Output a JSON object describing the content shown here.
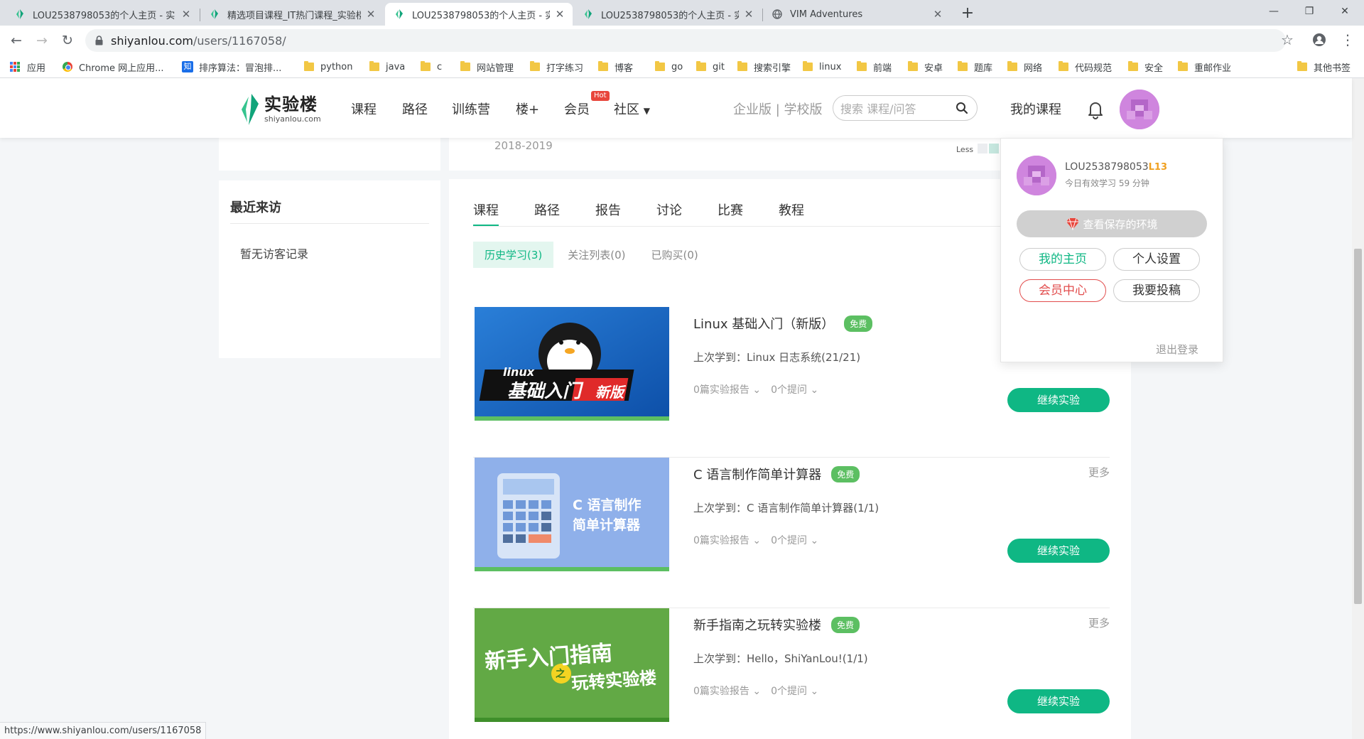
{
  "browser": {
    "tabs": [
      {
        "title": "LOU2538798053的个人主页 - 实",
        "active": false
      },
      {
        "title": "精选项目课程_IT热门课程_实验楼",
        "active": false
      },
      {
        "title": "LOU2538798053的个人主页 - 实",
        "active": true
      },
      {
        "title": "LOU2538798053的个人主页 - 实",
        "active": false
      },
      {
        "title": "VIM Adventures",
        "active": false
      }
    ],
    "url_host": "shiyanlou.com",
    "url_path": "/users/1167058/",
    "bookmarks": [
      {
        "label": "应用",
        "icon": "apps-grid-icon"
      },
      {
        "label": "Chrome 网上应用...",
        "icon": "chrome-icon"
      },
      {
        "label": "排序算法：冒泡排...",
        "icon": "zhihu-icon"
      },
      {
        "label": "python",
        "icon": "folder-icon"
      },
      {
        "label": "java",
        "icon": "folder-icon"
      },
      {
        "label": "c",
        "icon": "folder-icon"
      },
      {
        "label": "网站管理",
        "icon": "folder-icon"
      },
      {
        "label": "打字练习",
        "icon": "folder-icon"
      },
      {
        "label": "博客",
        "icon": "folder-icon"
      },
      {
        "label": "go",
        "icon": "folder-icon"
      },
      {
        "label": "git",
        "icon": "folder-icon"
      },
      {
        "label": "搜索引擎",
        "icon": "folder-icon"
      },
      {
        "label": "linux",
        "icon": "folder-icon"
      },
      {
        "label": "前端",
        "icon": "folder-icon"
      },
      {
        "label": "安卓",
        "icon": "folder-icon"
      },
      {
        "label": "题库",
        "icon": "folder-icon"
      },
      {
        "label": "网络",
        "icon": "folder-icon"
      },
      {
        "label": "代码规范",
        "icon": "folder-icon"
      },
      {
        "label": "安全",
        "icon": "folder-icon"
      },
      {
        "label": "重邮作业",
        "icon": "folder-icon"
      },
      {
        "label": "其他书签",
        "icon": "folder-icon"
      }
    ],
    "status_url": "https://www.shiyanlou.com/users/1167058"
  },
  "site": {
    "logo_cn": "实验楼",
    "logo_en": "shiyanlou.com",
    "nav": [
      "课程",
      "路径",
      "训练营",
      "楼+",
      "会员",
      "社区"
    ],
    "hot_badge": "Hot",
    "enterprise": "企业版 | 学校版",
    "search_placeholder": "搜索 课程/问答",
    "my_courses": "我的课程",
    "accent": "#0fb784"
  },
  "sidebar": {
    "recent_title": "最近来访",
    "recent_empty": "暂无访客记录"
  },
  "calendar": {
    "year_label": "2018-2019",
    "less_label": "Less"
  },
  "main": {
    "tabs": [
      "课程",
      "路径",
      "报告",
      "讨论",
      "比赛",
      "教程"
    ],
    "subtabs": [
      "历史学习(3)",
      "关注列表(0)",
      "已购买(0)"
    ],
    "courses": [
      {
        "title": "Linux 基础入门（新版）",
        "badge": "免费",
        "last": "上次学到：Linux 日志系统(21/21)",
        "reports": "0篇实验报告",
        "questions": "0个提问",
        "more": "",
        "button": "继续实验",
        "thumb_text_1": "linux",
        "thumb_text_2": "基础入门",
        "thumb_text_3": "新版"
      },
      {
        "title": "C 语言制作简单计算器",
        "badge": "免费",
        "last": "上次学到：C 语言制作简单计算器(1/1)",
        "reports": "0篇实验报告",
        "questions": "0个提问",
        "more": "更多",
        "button": "继续实验",
        "thumb_text_1": "C 语言制作",
        "thumb_text_2": "简单计算器"
      },
      {
        "title": "新手指南之玩转实验楼",
        "badge": "免费",
        "last": "上次学到：Hello，ShiYanLou!(1/1)",
        "reports": "0篇实验报告",
        "questions": "0个提问",
        "more": "更多",
        "button": "继续实验",
        "thumb_text_1": "新手入门指南",
        "thumb_text_2": "之",
        "thumb_text_3": "玩转实验楼"
      }
    ]
  },
  "dropdown": {
    "username": "LOU2538798053",
    "level": "L13",
    "today": "今日有效学习 59 分钟",
    "env_button": "查看保存的环境",
    "home": "我的主页",
    "settings": "个人设置",
    "vip": "会员中心",
    "contribute": "我要投稿",
    "logout": "退出登录"
  }
}
